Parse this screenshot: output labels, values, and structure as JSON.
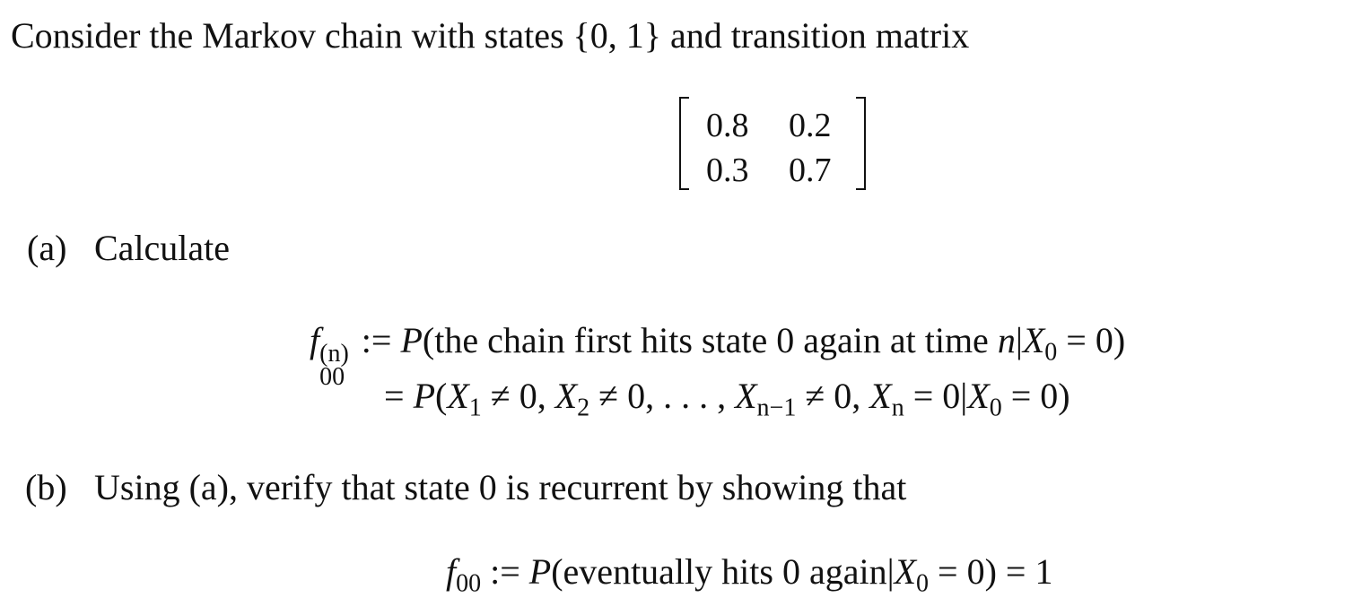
{
  "intro": "Consider the Markov chain with states {0, 1} and transition matrix",
  "matrix": [
    [
      "0.8",
      "0.2"
    ],
    [
      "0.3",
      "0.7"
    ]
  ],
  "part_a": {
    "label": "(a)",
    "text": "Calculate"
  },
  "part_b": {
    "label": "(b)",
    "text": "Using (a), verify that state 0 is recurrent by showing that"
  },
  "equations": {
    "eq_a1": [
      {
        "s": "it",
        "t": "f"
      },
      {
        "s": "subsup",
        "sup": "(n)",
        "sub": "00"
      },
      {
        "s": "rm",
        "t": " := "
      },
      {
        "s": "it",
        "t": "P"
      },
      {
        "s": "rm",
        "t": "(the chain first hits state 0 again at time "
      },
      {
        "s": "it",
        "t": "n"
      },
      {
        "s": "rm",
        "t": "|"
      },
      {
        "s": "it",
        "t": "X"
      },
      {
        "s": "sub",
        "t": "0"
      },
      {
        "s": "rm",
        "t": " = 0)"
      }
    ],
    "eq_a2": [
      {
        "s": "rm",
        "t": "= "
      },
      {
        "s": "it",
        "t": "P"
      },
      {
        "s": "rm",
        "t": "("
      },
      {
        "s": "it",
        "t": "X"
      },
      {
        "s": "sub",
        "t": "1"
      },
      {
        "s": "rm",
        "t": " ≠ 0, "
      },
      {
        "s": "it",
        "t": "X"
      },
      {
        "s": "sub",
        "t": "2"
      },
      {
        "s": "rm",
        "t": " ≠ 0, . . . , "
      },
      {
        "s": "it",
        "t": "X"
      },
      {
        "s": "sub",
        "t": "n−1"
      },
      {
        "s": "rm",
        "t": " ≠ 0, "
      },
      {
        "s": "it",
        "t": "X"
      },
      {
        "s": "sub",
        "t": "n"
      },
      {
        "s": "rm",
        "t": " = 0|"
      },
      {
        "s": "it",
        "t": "X"
      },
      {
        "s": "sub",
        "t": "0"
      },
      {
        "s": "rm",
        "t": " = 0)"
      }
    ],
    "eq_b": [
      {
        "s": "it",
        "t": "f"
      },
      {
        "s": "sub",
        "t": "00"
      },
      {
        "s": "rm",
        "t": " := "
      },
      {
        "s": "it",
        "t": "P"
      },
      {
        "s": "rm",
        "t": "(eventually hits 0 again|"
      },
      {
        "s": "it",
        "t": "X"
      },
      {
        "s": "sub",
        "t": "0"
      },
      {
        "s": "rm",
        "t": " = 0) = 1"
      }
    ]
  }
}
